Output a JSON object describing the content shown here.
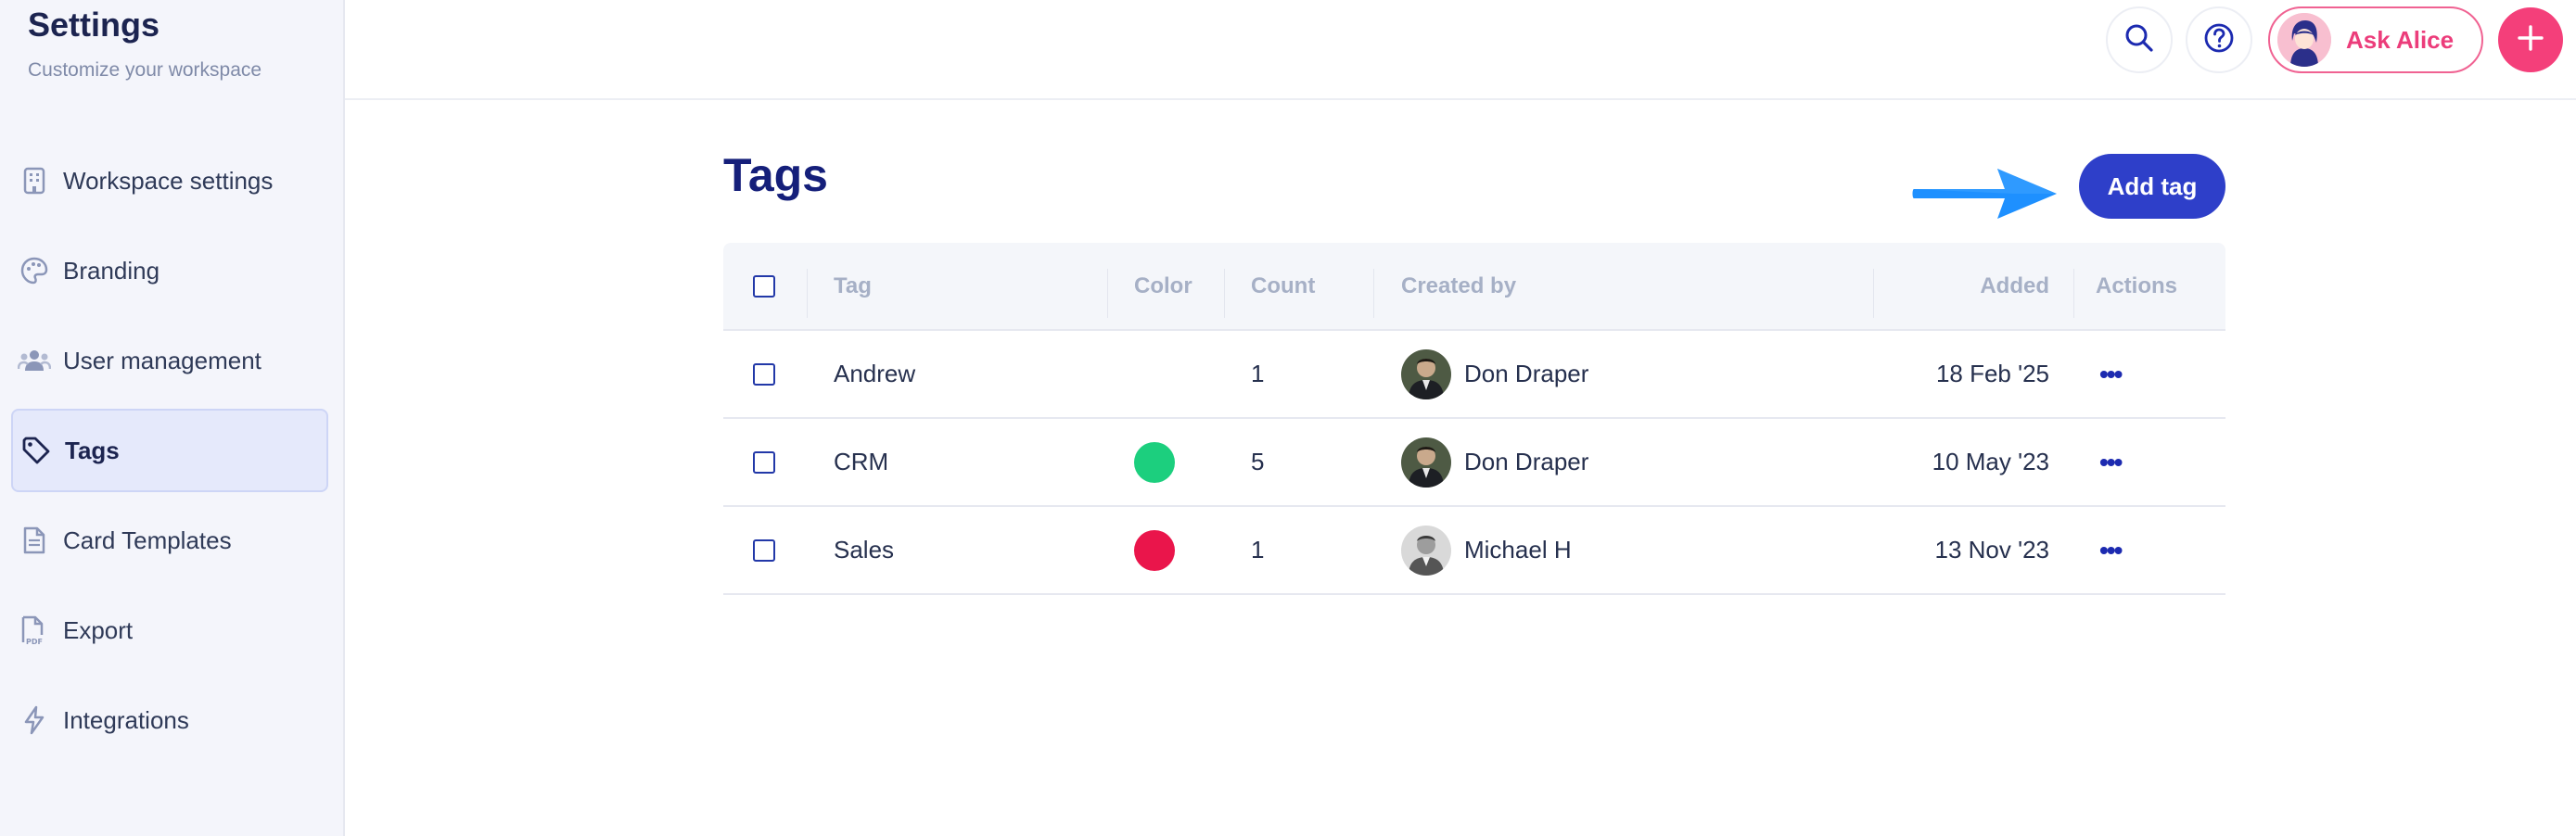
{
  "sidebar": {
    "title": "Settings",
    "subtitle": "Customize your workspace",
    "items": [
      {
        "label": "Workspace settings",
        "icon": "building-icon"
      },
      {
        "label": "Branding",
        "icon": "palette-icon"
      },
      {
        "label": "User management",
        "icon": "users-icon"
      },
      {
        "label": "Tags",
        "icon": "tag-icon",
        "active": true
      },
      {
        "label": "Card Templates",
        "icon": "document-icon"
      },
      {
        "label": "Export",
        "icon": "pdf-icon"
      },
      {
        "label": "Integrations",
        "icon": "lightning-icon"
      }
    ]
  },
  "topbar": {
    "ask_label": "Ask Alice",
    "icons": [
      "search-icon",
      "help-icon",
      "plus-icon"
    ]
  },
  "page": {
    "title": "Tags",
    "add_label": "Add tag"
  },
  "table": {
    "headers": {
      "tag": "Tag",
      "color": "Color",
      "count": "Count",
      "created_by": "Created by",
      "added": "Added",
      "actions": "Actions"
    },
    "rows": [
      {
        "tag": "Andrew",
        "color": "",
        "count": "1",
        "created_by": "Don Draper",
        "added": "18 Feb '25",
        "actions": "•••"
      },
      {
        "tag": "CRM",
        "color": "#1ccf7e",
        "count": "5",
        "created_by": "Don Draper",
        "added": "10 May '23",
        "actions": "•••"
      },
      {
        "tag": "Sales",
        "color": "#ea154b",
        "count": "1",
        "created_by": "Michael H",
        "added": "13 Nov '23",
        "actions": "•••"
      }
    ]
  },
  "colors": {
    "accent": "#2e3fc9",
    "brand_pink": "#f43f7a",
    "title_navy": "#151f7a",
    "arrow_blue": "#1e90ff"
  }
}
